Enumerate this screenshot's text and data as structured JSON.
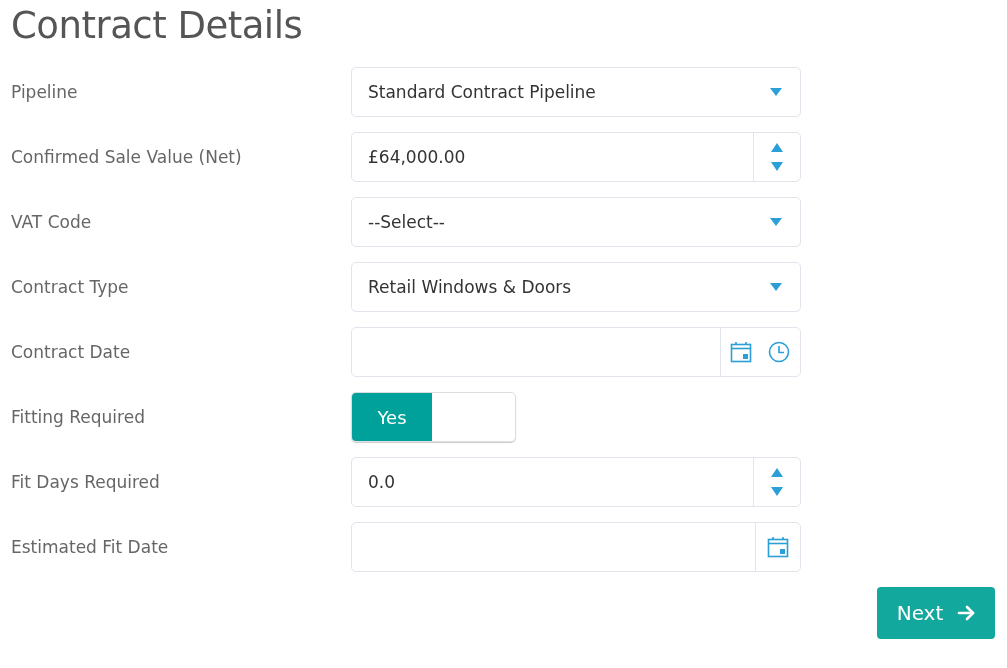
{
  "title": "Contract Details",
  "fields": [
    {
      "kind": "select",
      "label": "Pipeline",
      "value": "Standard Contract Pipeline"
    },
    {
      "kind": "number",
      "label": "Confirmed Sale Value (Net)",
      "value": "£64,000.00"
    },
    {
      "kind": "select",
      "label": "VAT Code",
      "value": "--Select--"
    },
    {
      "kind": "select",
      "label": "Contract Type",
      "value": "Retail Windows & Doors"
    },
    {
      "kind": "datetime",
      "label": "Contract Date"
    },
    {
      "kind": "toggle",
      "label": "Fitting Required",
      "on": true,
      "option": "Yes"
    },
    {
      "kind": "number",
      "label": "Fit Days Required",
      "value": "0.0"
    },
    {
      "kind": "date",
      "label": "Estimated Fit Date"
    }
  ],
  "next_button": "Next"
}
